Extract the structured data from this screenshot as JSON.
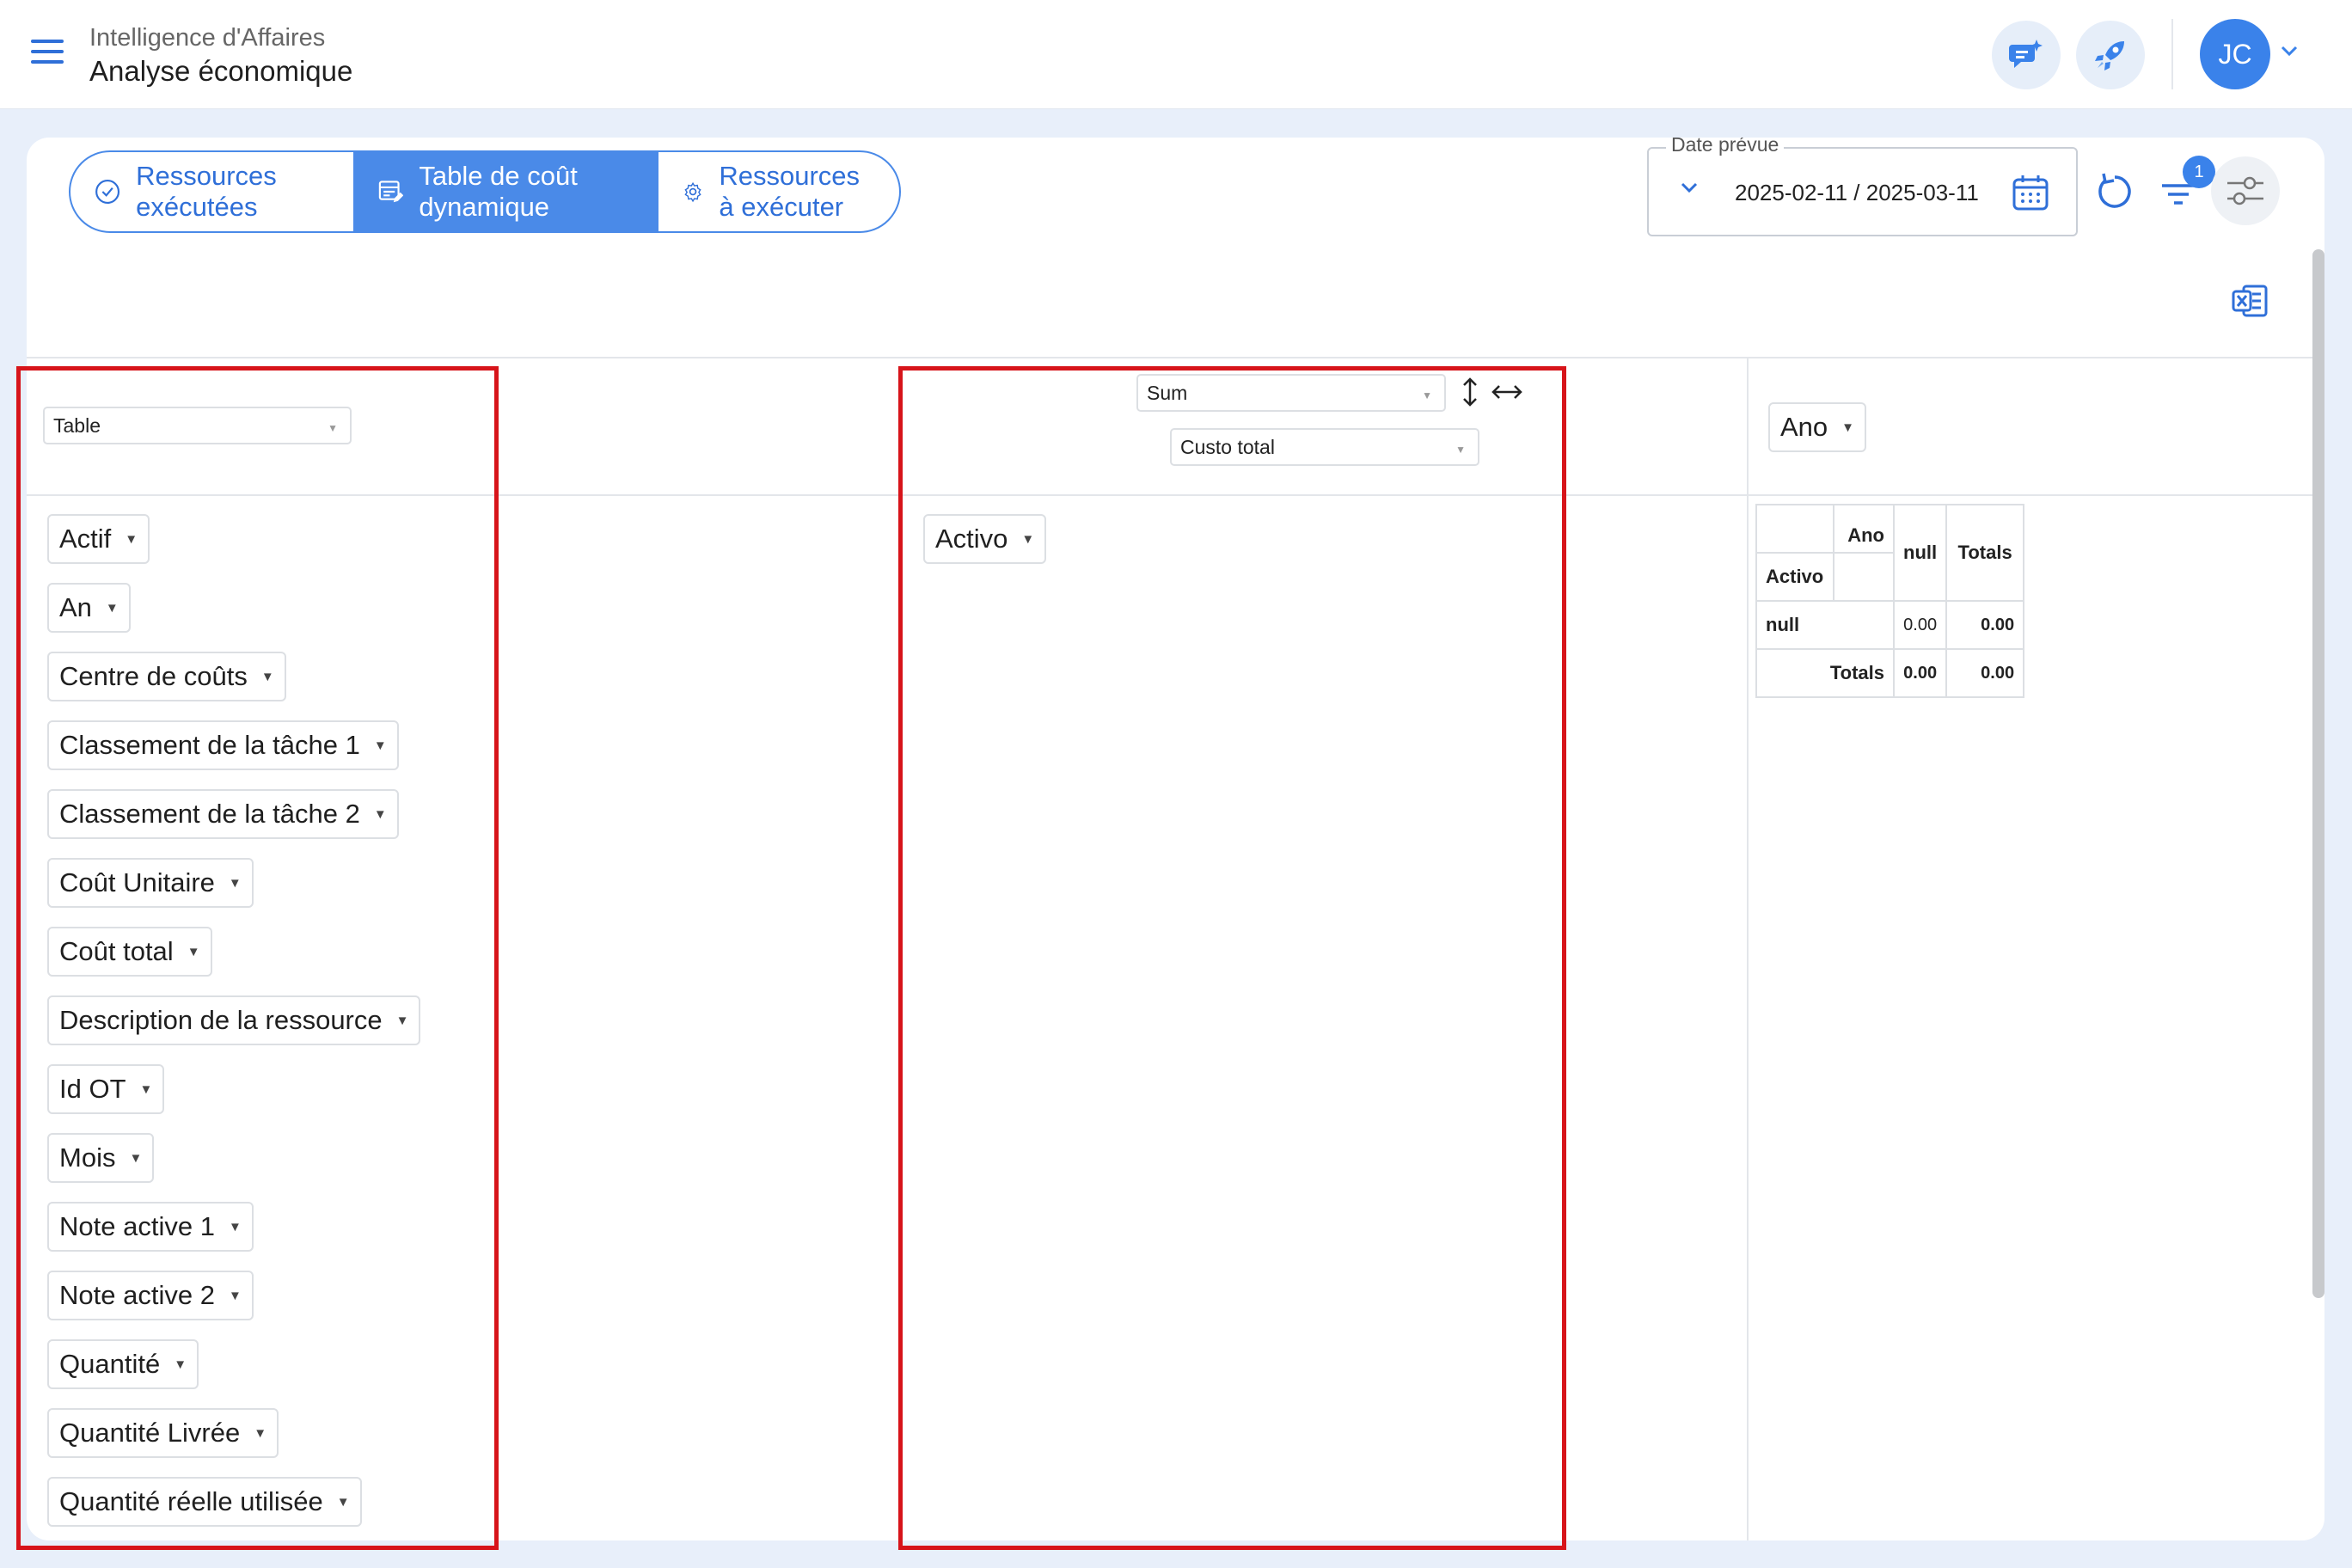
{
  "header": {
    "app_section": "Intelligence d'Affaires",
    "page_title": "Analyse économique",
    "user_initials": "JC"
  },
  "tabs": [
    {
      "label": "Ressources exécutées",
      "icon": "check-circle-icon"
    },
    {
      "label": "Table de coût dynamique",
      "icon": "table-edit-icon",
      "active": true
    },
    {
      "label": "Ressources à exécuter",
      "icon": "gear-icon"
    }
  ],
  "date_filter": {
    "legend": "Date prévue",
    "value": "2025-02-11 / 2025-03-11"
  },
  "filters_badge": "1",
  "pivot": {
    "renderer": "Table",
    "aggregator": "Sum",
    "aggregator_field": "Custo total",
    "unused_fields": [
      "Actif",
      "An",
      "Centre de coûts",
      "Classement de la tâche 1",
      "Classement de la tâche 2",
      "Coût Unitaire",
      "Coût total",
      "Description de la ressource",
      "Id OT",
      "Mois",
      "Note active 1",
      "Note active 2",
      "Quantité",
      "Quantité Livrée",
      "Quantité réelle utilisée"
    ],
    "row_fields": [
      "Activo"
    ],
    "col_fields": [
      "Ano"
    ],
    "table": {
      "col_attr_label": "Ano",
      "row_attr_label": "Activo",
      "col_header": "null",
      "totals_label": "Totals",
      "rows": [
        {
          "label": "null",
          "value": "0.00",
          "total": "0.00"
        }
      ],
      "col_total": "0.00",
      "grand_total": "0.00"
    }
  },
  "colors": {
    "accent": "#4a8ae8",
    "highlight_border": "#d7141a",
    "page_bg": "#e8effa"
  }
}
